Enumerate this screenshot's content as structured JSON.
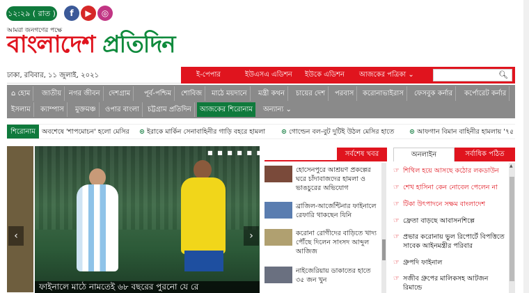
{
  "header": {
    "time": "১২:২৯ ( রাত )",
    "social": {
      "facebook": "f",
      "youtube": "▶",
      "instagram": "◎"
    },
    "tagline": "আমরা জনগণের পক্ষে",
    "logo_part1": "বাংলাদেশ",
    "logo_part2": " প্রতিদিন"
  },
  "date": "ঢাকা, রবিবার, ১১ জুলাই, ২০২১",
  "top_nav": [
    "ই-পেপার",
    "ইউএসএ এডিশন",
    "ইউকে এডিশন",
    "আজকের পত্রিকা ⌄"
  ],
  "search": {
    "placeholder": ""
  },
  "menu_row1": [
    "হোম",
    "জাতীয়",
    "নগর জীবন",
    "দেশগ্রাম",
    "পূর্ব-পশ্চিম",
    "শোবিজ",
    "মাঠে ময়দানে",
    "মন্ত্রী কথন",
    "চায়ের দেশ",
    "পরবাস",
    "করোনাভাইরাস",
    "ফেসবুক কর্নার",
    "কর্পোরেট কর্নার"
  ],
  "menu_row2": [
    "ইসলাম",
    "ক্যাম্পাস",
    "মুক্তমঞ্চ",
    "ওপার বাংলা",
    "চট্টগ্রাম প্রতিদিন",
    "আজকের শিরোনাম",
    "অন্যান্য ⌄"
  ],
  "ticker": {
    "label": "শিরোনাম",
    "items": [
      "অবশেষে 'শাপমোচন' হলো মেসির",
      "ইরাকে মার্কিন সেনাবাহিনীর গাড়ি বহরে হামলা",
      "গোল্ডেন বল-বুট দুটিই উঠল মেসির হাতে",
      "আফগান বিমান বাহিনীর হামলায় '৭৫"
    ]
  },
  "slider": {
    "caption": "ফাইনালে মাঠে নামতেই ৬৮ বছরের পুরনো যে রে",
    "prev": "‹",
    "next": "›",
    "dots": "■ ■ ■ ■ ■ ■"
  },
  "latest": {
    "tab": "সর্বশেষ খবর",
    "items": [
      "হোসেনপুরে আশ্রয়ণ প্রকল্পের ঘরে চাঁদাবাজদের হামলা ও ভাঙচুরের অভিযোগ",
      "ব্রাজিল-আর্জেন্টিনার ফাইনালে রেফারি থাকছেন যিনি",
      "করোনা রোগীদের বাড়িতে খাদ্য পৌঁছে দিলেন সাংসদ আব্দুল আজিজ",
      "নাইজেরিয়ায় ডাকাতের হাতে ৩৫ জন খুন"
    ]
  },
  "right_tabs": {
    "online": "অনলাইন",
    "most_read": "সর্বাধিক পঠিত"
  },
  "most_read": [
    {
      "text": "শিথিল হয়ে আসছে কঠোর লকডাউন",
      "red": true
    },
    {
      "text": "শেখ হাসিনা কেন নোবেল পেলেন না",
      "red": true
    },
    {
      "text": "টিকা উৎপাদনে সক্ষম বাংলাদেশ",
      "red": true
    },
    {
      "text": "ফ্রেতা বাড়ছে আবাসনশিল্পে",
      "red": false
    },
    {
      "text": "প্রভার করোনায় ভুল রিপোর্টে বিপত্তিতে সাবেক আইনমন্ত্রীর পরিবার",
      "red": false
    },
    {
      "text": "গ্রুপদি ফাইনাল",
      "red": false
    },
    {
      "text": "সজীব গ্রুপের মালিকসহ আটজন রিমান্ডে",
      "red": false
    }
  ],
  "colors": {
    "brand_red": "#e0141e",
    "brand_green": "#0f7a3c",
    "menu_grey": "#8a8a8a"
  }
}
